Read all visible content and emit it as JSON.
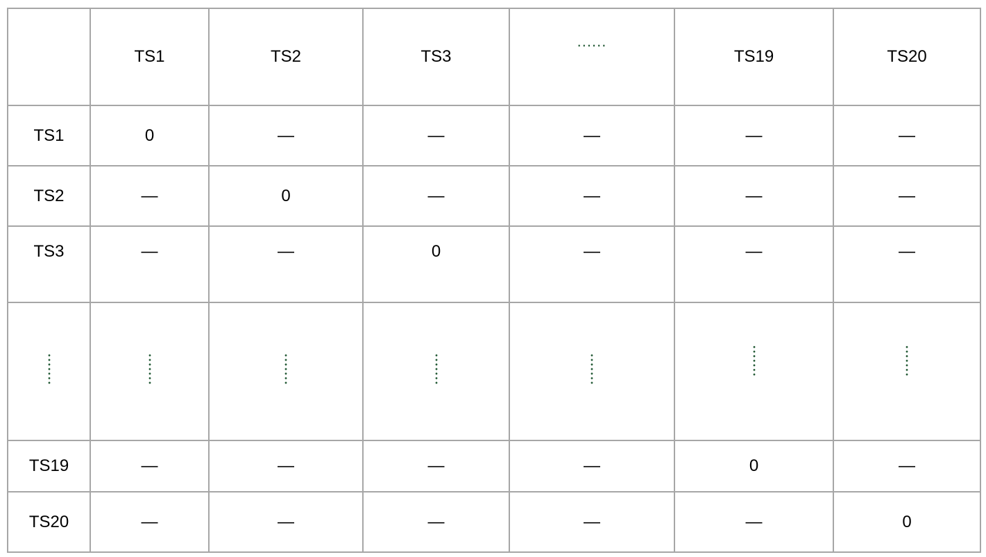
{
  "header": [
    "",
    "TS1",
    "TS2",
    "TS3",
    "......",
    "TS19",
    "TS20"
  ],
  "rows": [
    {
      "label": "TS1",
      "cells": [
        "0",
        "—",
        "—",
        "—",
        "—",
        "—"
      ]
    },
    {
      "label": "TS2",
      "cells": [
        "—",
        "0",
        "—",
        "—",
        "—",
        "—"
      ]
    },
    {
      "label": "TS3",
      "cells": [
        "—",
        "—",
        "0",
        "—",
        "—",
        "—"
      ]
    },
    {
      "label": "⋮",
      "cells": [
        "⋮",
        "⋮",
        "⋮",
        "⋮",
        "⋮",
        "⋮"
      ]
    },
    {
      "label": "TS19",
      "cells": [
        "—",
        "—",
        "—",
        "—",
        "0",
        "—"
      ]
    },
    {
      "label": "TS20",
      "cells": [
        "—",
        "—",
        "—",
        "—",
        "—",
        "0"
      ]
    }
  ],
  "colors": {
    "border": "#a6a6a6",
    "ellipsis": "#1e5631",
    "text": "#000000"
  }
}
